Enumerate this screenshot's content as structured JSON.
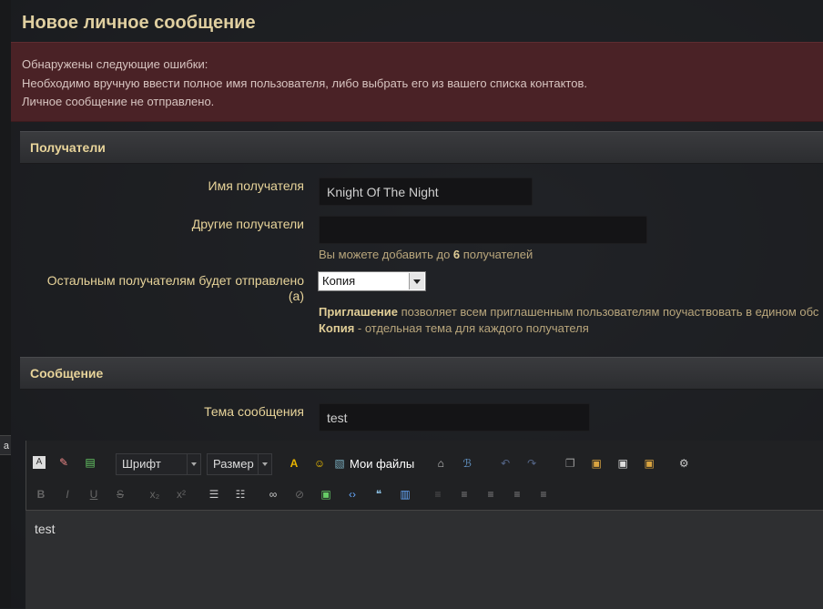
{
  "page_title": "Новое личное сообщение",
  "errors": {
    "line1": "Обнаружены следующие ошибки:",
    "line2": "Необходимо вручную ввести полное имя пользователя, либо выбрать его из вашего списка контактов.",
    "line3": "Личное сообщение не отправлено."
  },
  "recipients": {
    "header": "Получатели",
    "name_label": "Имя получателя",
    "name_value": "Knight Of The Night",
    "others_label": "Другие получатели",
    "others_value": "",
    "others_hint_pre": "Вы можете добавить до ",
    "others_hint_num": "6",
    "others_hint_post": " получателей",
    "send_label_1": "Остальным получателям будет отправлено",
    "send_label_2": "(а)",
    "send_value": "Копия",
    "hint_invite_b": "Приглашение",
    "hint_invite": " позволяет всем приглашенным пользователям поучаствовать в едином обс",
    "hint_copy_b": "Копия",
    "hint_copy": " - отдельная тема для каждого получателя"
  },
  "message": {
    "header": "Сообщение",
    "subject_label": "Тема сообщения",
    "subject_value": "test",
    "body": "test"
  },
  "toolbar": {
    "font_label": "Шрифт",
    "size_label": "Размер",
    "my_files": "Мои файлы"
  },
  "left_mark": "a"
}
